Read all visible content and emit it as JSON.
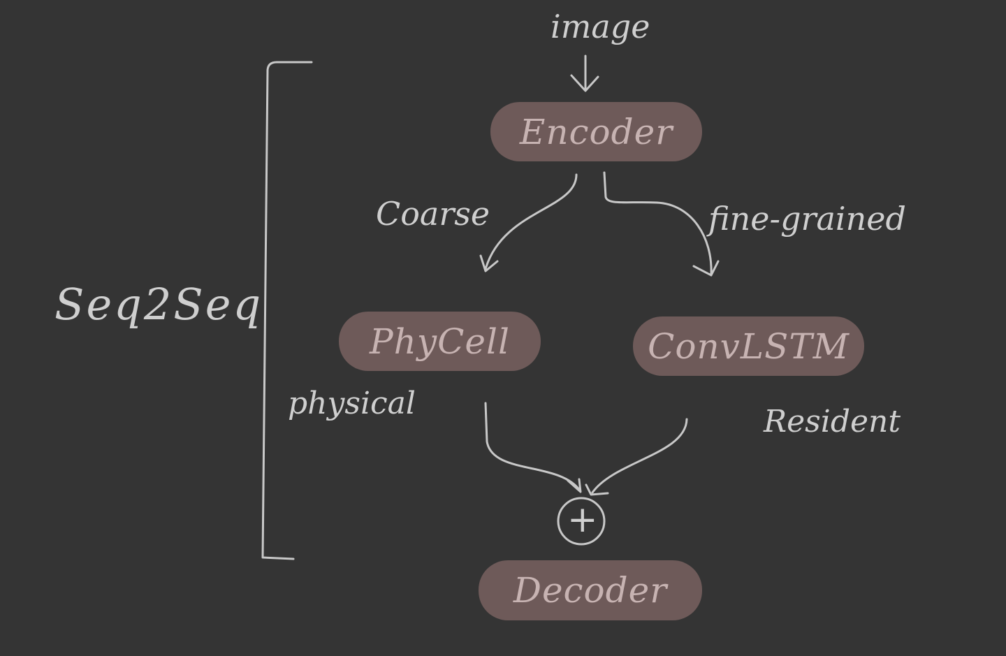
{
  "diagram": {
    "input_label": "image",
    "bracket_label": "Seq2Seq",
    "nodes": {
      "encoder": "Encoder",
      "phycell": "PhyCell",
      "convlstm": "ConvLSTM",
      "decoder": "Decoder"
    },
    "edge_labels": {
      "coarse": "Coarse",
      "fine_grained": "fine-grained",
      "physical": "physical",
      "resident": "Resident"
    },
    "combine_symbol": "+"
  },
  "colors": {
    "background": "#343434",
    "node_fill": "#6e5a59",
    "node_text": "#c7b3b2",
    "stroke": "#c8c8c8"
  }
}
